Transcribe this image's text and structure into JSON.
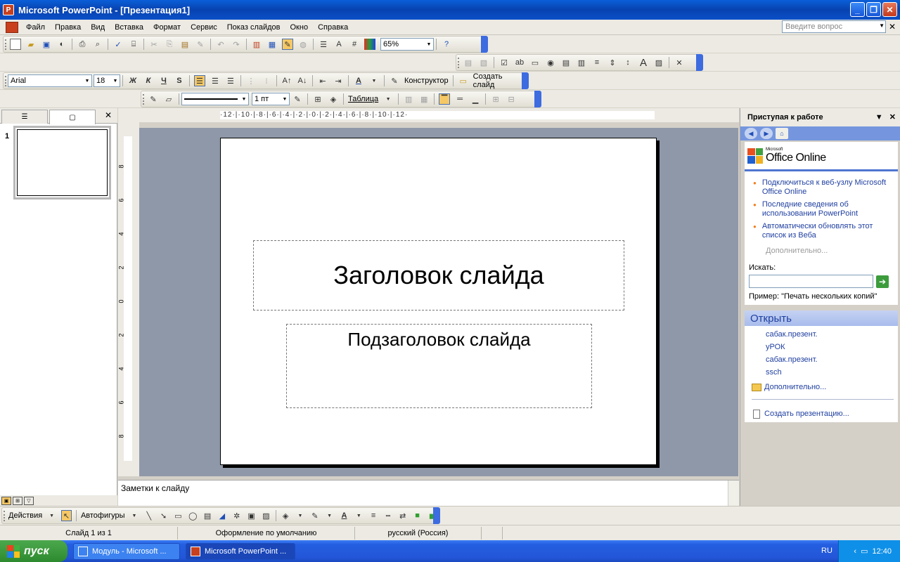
{
  "window": {
    "title": "Microsoft PowerPoint - [Презентация1]"
  },
  "menu": {
    "items": [
      "Файл",
      "Правка",
      "Вид",
      "Вставка",
      "Формат",
      "Сервис",
      "Показ слайдов",
      "Окно",
      "Справка"
    ],
    "help_placeholder": "Введите вопрос"
  },
  "toolbar_standard": {
    "zoom": "65%"
  },
  "toolbar_format": {
    "font": "Arial",
    "size": "18",
    "bold": "Ж",
    "italic": "К",
    "underline": "Ч",
    "shadow": "S",
    "designer": "Конструктор",
    "new_slide": "Создать слайд"
  },
  "toolbar_table": {
    "line_width": "1 пт",
    "table": "Таблица"
  },
  "left_panel": {
    "slide_number": "1"
  },
  "slide": {
    "title": "Заголовок слайда",
    "subtitle": "Подзаголовок слайда"
  },
  "ruler": {
    "horizontal": "·12·|·10·|·8·|·6·|·4·|·2·|·0·|·2·|·4·|·6·|·8·|·10·|·12·",
    "vertical_ticks": [
      "8",
      "6",
      "4",
      "2",
      "0",
      "2",
      "4",
      "6",
      "8"
    ]
  },
  "notes": {
    "placeholder": "Заметки к слайду"
  },
  "task_pane": {
    "title": "Приступая к работе",
    "logo_small": "Microsoft",
    "logo_big": "Office Online",
    "links": [
      "Подключиться к веб-узлу Microsoft Office Online",
      "Последние сведения об использовании PowerPoint",
      "Автоматически обновлять этот список из Веба"
    ],
    "more": "Дополнительно...",
    "search_label": "Искать:",
    "search_example": "Пример:  \"Печать нескольких копий\"",
    "open_title": "Открыть",
    "files": [
      "сабак.презент.",
      "уРОК",
      "сабак.презент.",
      "ssch"
    ],
    "open_more": "Дополнительно...",
    "create": "Создать презентацию..."
  },
  "drawing_toolbar": {
    "actions": "Действия",
    "autoshapes": "Автофигуры"
  },
  "status_bar": {
    "slide": "Слайд 1 из 1",
    "design": "Оформление по умолчанию",
    "language": "русский (Россия)"
  },
  "taskbar": {
    "start": "пуск",
    "tasks": [
      "Модуль - Microsoft ...",
      "Microsoft PowerPoint ..."
    ],
    "lang": "RU",
    "time": "12:40"
  }
}
